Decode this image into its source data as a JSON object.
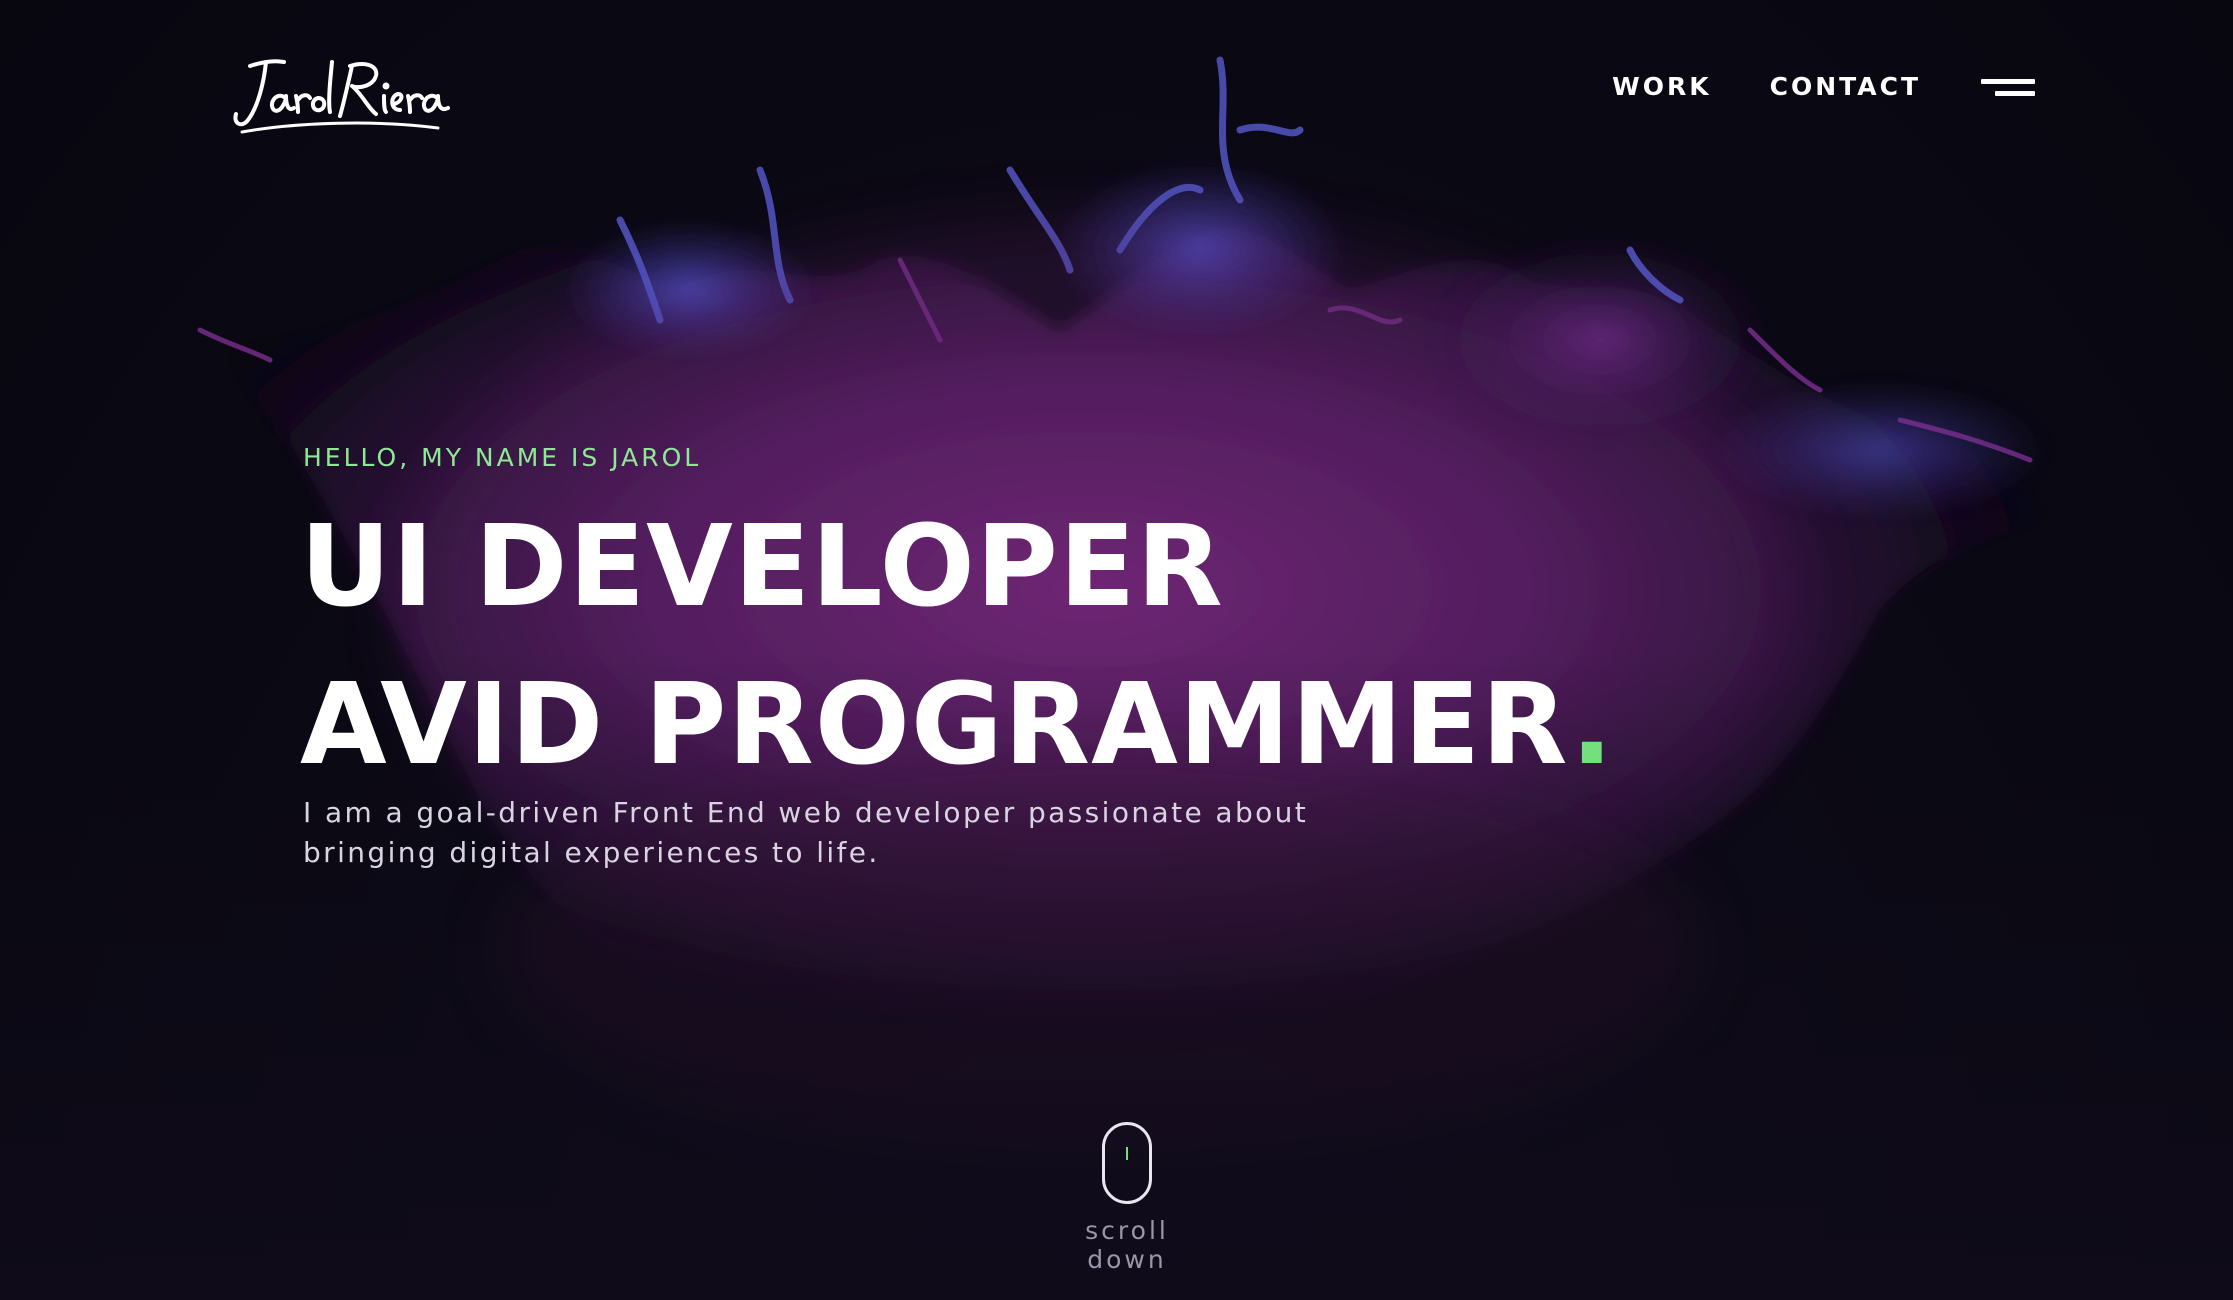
{
  "brand": {
    "logo_text": "JarolRiera"
  },
  "nav": {
    "items": [
      {
        "label": "WORK"
      },
      {
        "label": "CONTACT"
      }
    ],
    "menu_icon": "hamburger-menu-icon"
  },
  "hero": {
    "eyebrow": "HELLO, MY NAME IS JAROL",
    "line1": "UI DEVELOPER",
    "line2": "AVID PROGRAMMER",
    "line2_dot": ".",
    "description": "I am a goal-driven Front End web developer passionate about bringing digital experiences to life."
  },
  "scroll": {
    "label": "scroll down",
    "icon": "mouse-scroll-icon"
  },
  "colors": {
    "background": "#0b0914",
    "accent_green": "#74e07d",
    "eyebrow_green": "#8fe896",
    "text_white": "#ffffff",
    "splash_purple": "#8a2a8c",
    "splash_blue": "#4a4ab8"
  }
}
